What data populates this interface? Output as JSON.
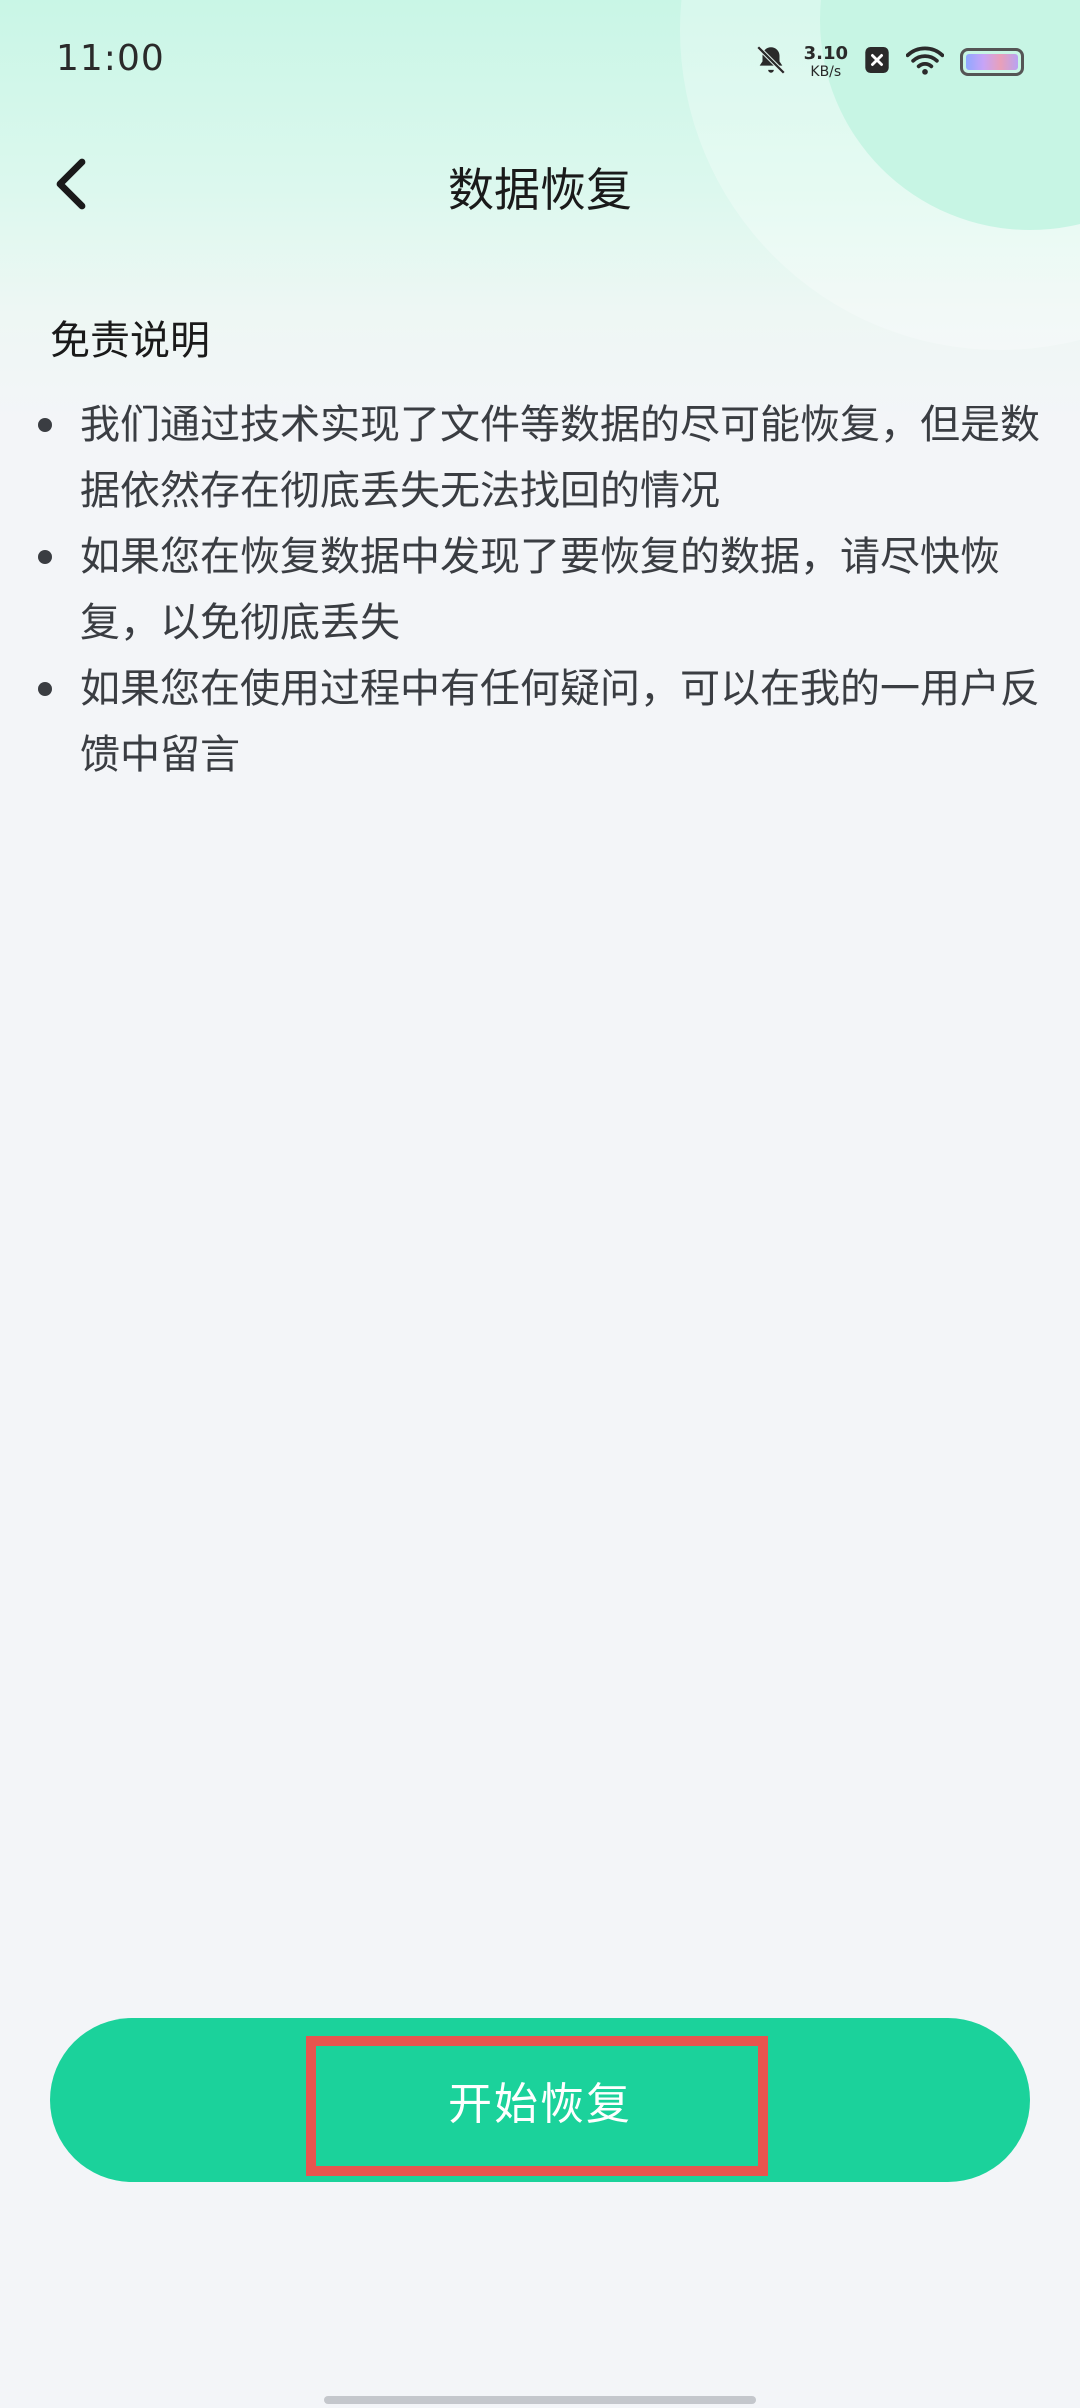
{
  "status_bar": {
    "time": "11:00",
    "net_speed_value": "3.10",
    "net_speed_unit": "KB/s",
    "icons": [
      "bell-off-icon",
      "close-box-icon",
      "wifi-icon",
      "battery-icon"
    ]
  },
  "header": {
    "title": "数据恢复",
    "back_icon": "chevron-left-icon"
  },
  "disclaimer": {
    "title": "免责说明",
    "items": [
      "我们通过技术实现了文件等数据的尽可能恢复，但是数据依然存在彻底丢失无法找回的情况",
      "如果您在恢复数据中发现了要恢复的数据，请尽快恢复，以免彻底丢失",
      "如果您在使用过程中有任何疑问，可以在我的一用户反馈中留言"
    ]
  },
  "action": {
    "start_label": "开始恢复",
    "button_color": "#1bd29b",
    "highlight_color": "#e8544e"
  }
}
